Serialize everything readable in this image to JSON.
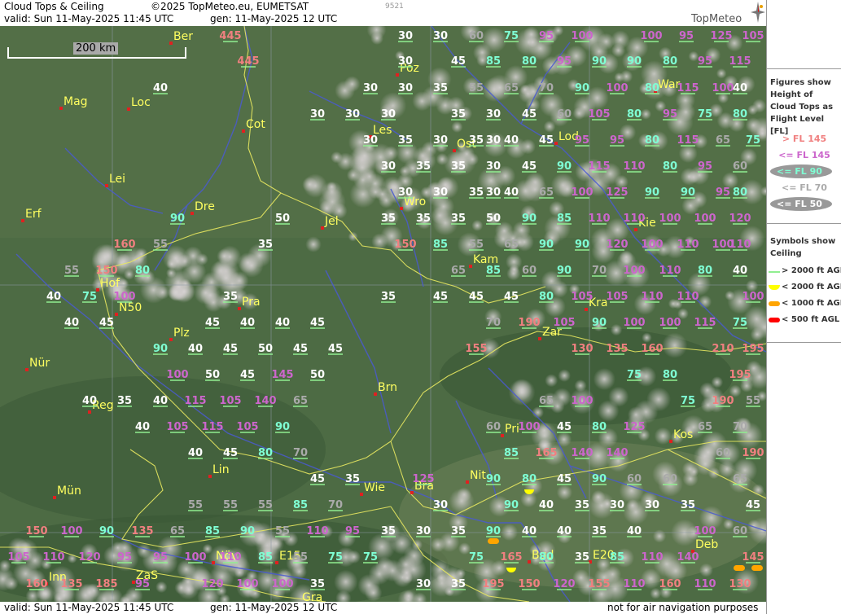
{
  "header": {
    "title": "Cloud Tops & Ceiling",
    "copyright": "©2025 TopMeteo.eu, EUMETSAT",
    "code": "9521",
    "valid": "valid:  Sun  11-May-2025  11:45 UTC",
    "gen": "gen: 11-May-2025 12 UTC",
    "brand": "TopMeteo"
  },
  "footer": {
    "valid": "valid:  Sun  11-May-2025  11:45 UTC",
    "gen": "gen: 11-May-2025 12 UTC",
    "disclaimer": "not for air navigation purposes"
  },
  "scale_label": "200 km",
  "legend": {
    "figures_title": "Figures show Height of Cloud Tops as Flight Level  [FL]",
    "levels": [
      {
        "label": "> FL 145",
        "color": "#f08080"
      },
      {
        "label": "<= FL 145",
        "color": "#cc66cc"
      },
      {
        "label": "<= FL 90",
        "color": "#7fffd4"
      },
      {
        "label": "<= FL 70",
        "color": "#aaaaaa"
      },
      {
        "label": "<= FL 50",
        "color": "#ffffff"
      }
    ],
    "symbols_title": "Symbols show Ceiling",
    "symbols": [
      {
        "label": "> 2000 ft AGL",
        "color": "#90ee90",
        "shape": "line"
      },
      {
        "label": "< 2000 ft AGL",
        "color": "#ffff00",
        "shape": "half-disc"
      },
      {
        "label": "< 1000 ft AGL",
        "color": "#ffa500",
        "shape": "pill"
      },
      {
        "label": "< 500 ft AGL",
        "color": "#ff0000",
        "shape": "pill"
      }
    ]
  },
  "cities": [
    "Ber",
    "Poz",
    "War",
    "Mag",
    "Loc",
    "Cot",
    "Les",
    "Lod",
    "Ost",
    "Lei",
    "Wro",
    "Kie",
    "Erf",
    "Dre",
    "Jel",
    "Kam",
    "Hof",
    "N50",
    "Pra",
    "Kra",
    "Plz",
    "Zar",
    "Nür",
    "Brn",
    "Reg",
    "Pri",
    "Kos",
    "Lin",
    "Nit",
    "Mün",
    "Wie",
    "Bra",
    "Bud",
    "E20",
    "Deb",
    "Inn",
    "ZaS",
    "Növ",
    "E15",
    "Gra",
    "Lie"
  ],
  "figures": [
    {
      "t": "445",
      "c": "#f08080"
    },
    {
      "t": "30",
      "c": "#ffffff"
    },
    {
      "t": "30",
      "c": "#ffffff"
    },
    {
      "t": "60",
      "c": "#aaaaaa"
    },
    {
      "t": "75",
      "c": "#7fffd4"
    },
    {
      "t": "95",
      "c": "#cc66cc"
    },
    {
      "t": "100",
      "c": "#cc66cc"
    },
    {
      "t": "100",
      "c": "#cc66cc"
    },
    {
      "t": "95",
      "c": "#cc66cc"
    },
    {
      "t": "125",
      "c": "#cc66cc"
    },
    {
      "t": "105",
      "c": "#cc66cc"
    },
    {
      "t": "445",
      "c": "#f08080"
    },
    {
      "t": "30",
      "c": "#ffffff"
    },
    {
      "t": "45",
      "c": "#ffffff"
    },
    {
      "t": "85",
      "c": "#7fffd4"
    },
    {
      "t": "80",
      "c": "#7fffd4"
    },
    {
      "t": "95",
      "c": "#cc66cc"
    },
    {
      "t": "90",
      "c": "#7fffd4"
    },
    {
      "t": "90",
      "c": "#7fffd4"
    },
    {
      "t": "80",
      "c": "#7fffd4"
    },
    {
      "t": "95",
      "c": "#cc66cc"
    },
    {
      "t": "115",
      "c": "#cc66cc"
    },
    {
      "t": "40",
      "c": "#ffffff"
    },
    {
      "t": "30",
      "c": "#ffffff"
    },
    {
      "t": "30",
      "c": "#ffffff"
    },
    {
      "t": "35",
      "c": "#ffffff"
    },
    {
      "t": "55",
      "c": "#aaaaaa"
    },
    {
      "t": "65",
      "c": "#aaaaaa"
    },
    {
      "t": "70",
      "c": "#aaaaaa"
    },
    {
      "t": "90",
      "c": "#7fffd4"
    },
    {
      "t": "100",
      "c": "#cc66cc"
    },
    {
      "t": "80",
      "c": "#7fffd4"
    },
    {
      "t": "115",
      "c": "#cc66cc"
    },
    {
      "t": "100",
      "c": "#cc66cc"
    },
    {
      "t": "40",
      "c": "#ffffff"
    },
    {
      "t": "30",
      "c": "#ffffff"
    },
    {
      "t": "30",
      "c": "#ffffff"
    },
    {
      "t": "30",
      "c": "#ffffff"
    },
    {
      "t": "35",
      "c": "#ffffff"
    },
    {
      "t": "30",
      "c": "#ffffff"
    },
    {
      "t": "45",
      "c": "#ffffff"
    },
    {
      "t": "60",
      "c": "#aaaaaa"
    },
    {
      "t": "105",
      "c": "#cc66cc"
    },
    {
      "t": "80",
      "c": "#7fffd4"
    },
    {
      "t": "95",
      "c": "#cc66cc"
    },
    {
      "t": "75",
      "c": "#7fffd4"
    },
    {
      "t": "80",
      "c": "#7fffd4"
    },
    {
      "t": "30",
      "c": "#ffffff"
    },
    {
      "t": "35",
      "c": "#ffffff"
    },
    {
      "t": "30",
      "c": "#ffffff"
    },
    {
      "t": "35",
      "c": "#ffffff"
    },
    {
      "t": "30",
      "c": "#ffffff"
    },
    {
      "t": "40",
      "c": "#ffffff"
    },
    {
      "t": "45",
      "c": "#ffffff"
    },
    {
      "t": "95",
      "c": "#cc66cc"
    },
    {
      "t": "95",
      "c": "#cc66cc"
    },
    {
      "t": "80",
      "c": "#7fffd4"
    },
    {
      "t": "115",
      "c": "#cc66cc"
    },
    {
      "t": "65",
      "c": "#aaaaaa"
    },
    {
      "t": "75",
      "c": "#7fffd4"
    },
    {
      "t": "30",
      "c": "#ffffff"
    },
    {
      "t": "35",
      "c": "#ffffff"
    },
    {
      "t": "35",
      "c": "#ffffff"
    },
    {
      "t": "30",
      "c": "#ffffff"
    },
    {
      "t": "45",
      "c": "#ffffff"
    },
    {
      "t": "90",
      "c": "#7fffd4"
    },
    {
      "t": "115",
      "c": "#cc66cc"
    },
    {
      "t": "110",
      "c": "#cc66cc"
    },
    {
      "t": "80",
      "c": "#7fffd4"
    },
    {
      "t": "95",
      "c": "#cc66cc"
    },
    {
      "t": "60",
      "c": "#aaaaaa"
    },
    {
      "t": "30",
      "c": "#ffffff"
    },
    {
      "t": "30",
      "c": "#ffffff"
    },
    {
      "t": "35",
      "c": "#ffffff"
    },
    {
      "t": "30",
      "c": "#ffffff"
    },
    {
      "t": "40",
      "c": "#ffffff"
    },
    {
      "t": "65",
      "c": "#aaaaaa"
    },
    {
      "t": "100",
      "c": "#cc66cc"
    },
    {
      "t": "125",
      "c": "#cc66cc"
    },
    {
      "t": "90",
      "c": "#7fffd4"
    },
    {
      "t": "90",
      "c": "#7fffd4"
    },
    {
      "t": "95",
      "c": "#cc66cc"
    },
    {
      "t": "80",
      "c": "#7fffd4"
    },
    {
      "t": "90",
      "c": "#7fffd4"
    },
    {
      "t": "50",
      "c": "#ffffff"
    },
    {
      "t": "35",
      "c": "#ffffff"
    },
    {
      "t": "35",
      "c": "#ffffff"
    },
    {
      "t": "35",
      "c": "#ffffff"
    },
    {
      "t": "50",
      "c": "#ffffff"
    },
    {
      "t": "90",
      "c": "#7fffd4"
    },
    {
      "t": "85",
      "c": "#7fffd4"
    },
    {
      "t": "110",
      "c": "#cc66cc"
    },
    {
      "t": "110",
      "c": "#cc66cc"
    },
    {
      "t": "100",
      "c": "#cc66cc"
    },
    {
      "t": "100",
      "c": "#cc66cc"
    },
    {
      "t": "120",
      "c": "#cc66cc"
    },
    {
      "t": "160",
      "c": "#f08080"
    },
    {
      "t": "55",
      "c": "#aaaaaa"
    },
    {
      "t": "35",
      "c": "#ffffff"
    },
    {
      "t": "150",
      "c": "#f08080"
    },
    {
      "t": "85",
      "c": "#7fffd4"
    },
    {
      "t": "55",
      "c": "#aaaaaa"
    },
    {
      "t": "65",
      "c": "#aaaaaa"
    },
    {
      "t": "90",
      "c": "#7fffd4"
    },
    {
      "t": "90",
      "c": "#7fffd4"
    },
    {
      "t": "120",
      "c": "#cc66cc"
    },
    {
      "t": "100",
      "c": "#cc66cc"
    },
    {
      "t": "110",
      "c": "#cc66cc"
    },
    {
      "t": "100",
      "c": "#cc66cc"
    },
    {
      "t": "110",
      "c": "#cc66cc"
    },
    {
      "t": "55",
      "c": "#aaaaaa"
    },
    {
      "t": "150",
      "c": "#f08080"
    },
    {
      "t": "80",
      "c": "#7fffd4"
    },
    {
      "t": "65",
      "c": "#aaaaaa"
    },
    {
      "t": "85",
      "c": "#7fffd4"
    },
    {
      "t": "60",
      "c": "#aaaaaa"
    },
    {
      "t": "90",
      "c": "#7fffd4"
    },
    {
      "t": "70",
      "c": "#aaaaaa"
    },
    {
      "t": "100",
      "c": "#cc66cc"
    },
    {
      "t": "110",
      "c": "#cc66cc"
    },
    {
      "t": "80",
      "c": "#7fffd4"
    },
    {
      "t": "40",
      "c": "#ffffff"
    },
    {
      "t": "40",
      "c": "#ffffff"
    },
    {
      "t": "75",
      "c": "#7fffd4"
    },
    {
      "t": "100",
      "c": "#cc66cc"
    },
    {
      "t": "35",
      "c": "#ffffff"
    },
    {
      "t": "35",
      "c": "#ffffff"
    },
    {
      "t": "45",
      "c": "#ffffff"
    },
    {
      "t": "45",
      "c": "#ffffff"
    },
    {
      "t": "45",
      "c": "#ffffff"
    },
    {
      "t": "80",
      "c": "#7fffd4"
    },
    {
      "t": "105",
      "c": "#cc66cc"
    },
    {
      "t": "105",
      "c": "#cc66cc"
    },
    {
      "t": "110",
      "c": "#cc66cc"
    },
    {
      "t": "110",
      "c": "#cc66cc"
    },
    {
      "t": "100",
      "c": "#cc66cc"
    },
    {
      "t": "40",
      "c": "#ffffff"
    },
    {
      "t": "45",
      "c": "#ffffff"
    },
    {
      "t": "45",
      "c": "#ffffff"
    },
    {
      "t": "40",
      "c": "#ffffff"
    },
    {
      "t": "40",
      "c": "#ffffff"
    },
    {
      "t": "45",
      "c": "#ffffff"
    },
    {
      "t": "70",
      "c": "#aaaaaa"
    },
    {
      "t": "190",
      "c": "#f08080"
    },
    {
      "t": "105",
      "c": "#cc66cc"
    },
    {
      "t": "90",
      "c": "#7fffd4"
    },
    {
      "t": "100",
      "c": "#cc66cc"
    },
    {
      "t": "100",
      "c": "#cc66cc"
    },
    {
      "t": "115",
      "c": "#cc66cc"
    },
    {
      "t": "75",
      "c": "#7fffd4"
    },
    {
      "t": "90",
      "c": "#7fffd4"
    },
    {
      "t": "40",
      "c": "#ffffff"
    },
    {
      "t": "45",
      "c": "#ffffff"
    },
    {
      "t": "50",
      "c": "#ffffff"
    },
    {
      "t": "45",
      "c": "#ffffff"
    },
    {
      "t": "45",
      "c": "#ffffff"
    },
    {
      "t": "155",
      "c": "#f08080"
    },
    {
      "t": "130",
      "c": "#f08080"
    },
    {
      "t": "135",
      "c": "#f08080"
    },
    {
      "t": "160",
      "c": "#f08080"
    },
    {
      "t": "210",
      "c": "#f08080"
    },
    {
      "t": "195",
      "c": "#f08080"
    },
    {
      "t": "100",
      "c": "#cc66cc"
    },
    {
      "t": "50",
      "c": "#ffffff"
    },
    {
      "t": "45",
      "c": "#ffffff"
    },
    {
      "t": "145",
      "c": "#cc66cc"
    },
    {
      "t": "50",
      "c": "#ffffff"
    },
    {
      "t": "75",
      "c": "#7fffd4"
    },
    {
      "t": "80",
      "c": "#7fffd4"
    },
    {
      "t": "195",
      "c": "#f08080"
    },
    {
      "t": "40",
      "c": "#ffffff"
    },
    {
      "t": "35",
      "c": "#ffffff"
    },
    {
      "t": "40",
      "c": "#ffffff"
    },
    {
      "t": "115",
      "c": "#cc66cc"
    },
    {
      "t": "105",
      "c": "#cc66cc"
    },
    {
      "t": "140",
      "c": "#cc66cc"
    },
    {
      "t": "65",
      "c": "#aaaaaa"
    },
    {
      "t": "65",
      "c": "#aaaaaa"
    },
    {
      "t": "100",
      "c": "#cc66cc"
    },
    {
      "t": "75",
      "c": "#7fffd4"
    },
    {
      "t": "190",
      "c": "#f08080"
    },
    {
      "t": "55",
      "c": "#aaaaaa"
    },
    {
      "t": "40",
      "c": "#ffffff"
    },
    {
      "t": "105",
      "c": "#cc66cc"
    },
    {
      "t": "115",
      "c": "#cc66cc"
    },
    {
      "t": "105",
      "c": "#cc66cc"
    },
    {
      "t": "90",
      "c": "#7fffd4"
    },
    {
      "t": "60",
      "c": "#aaaaaa"
    },
    {
      "t": "100",
      "c": "#cc66cc"
    },
    {
      "t": "45",
      "c": "#ffffff"
    },
    {
      "t": "80",
      "c": "#7fffd4"
    },
    {
      "t": "125",
      "c": "#cc66cc"
    },
    {
      "t": "65",
      "c": "#aaaaaa"
    },
    {
      "t": "70",
      "c": "#aaaaaa"
    },
    {
      "t": "40",
      "c": "#ffffff"
    },
    {
      "t": "45",
      "c": "#ffffff"
    },
    {
      "t": "80",
      "c": "#7fffd4"
    },
    {
      "t": "70",
      "c": "#aaaaaa"
    },
    {
      "t": "85",
      "c": "#7fffd4"
    },
    {
      "t": "165",
      "c": "#f08080"
    },
    {
      "t": "140",
      "c": "#cc66cc"
    },
    {
      "t": "140",
      "c": "#cc66cc"
    },
    {
      "t": "60",
      "c": "#aaaaaa"
    },
    {
      "t": "190",
      "c": "#f08080"
    },
    {
      "t": "45",
      "c": "#ffffff"
    },
    {
      "t": "35",
      "c": "#ffffff"
    },
    {
      "t": "125",
      "c": "#cc66cc"
    },
    {
      "t": "90",
      "c": "#7fffd4"
    },
    {
      "t": "80",
      "c": "#7fffd4"
    },
    {
      "t": "45",
      "c": "#ffffff"
    },
    {
      "t": "90",
      "c": "#7fffd4"
    },
    {
      "t": "60",
      "c": "#aaaaaa"
    },
    {
      "t": "60",
      "c": "#aaaaaa"
    },
    {
      "t": "65",
      "c": "#aaaaaa"
    },
    {
      "t": "55",
      "c": "#aaaaaa"
    },
    {
      "t": "55",
      "c": "#aaaaaa"
    },
    {
      "t": "55",
      "c": "#aaaaaa"
    },
    {
      "t": "85",
      "c": "#7fffd4"
    },
    {
      "t": "70",
      "c": "#aaaaaa"
    },
    {
      "t": "30",
      "c": "#ffffff"
    },
    {
      "t": "90",
      "c": "#7fffd4"
    },
    {
      "t": "40",
      "c": "#ffffff"
    },
    {
      "t": "35",
      "c": "#ffffff"
    },
    {
      "t": "30",
      "c": "#ffffff"
    },
    {
      "t": "30",
      "c": "#ffffff"
    },
    {
      "t": "35",
      "c": "#ffffff"
    },
    {
      "t": "45",
      "c": "#ffffff"
    },
    {
      "t": "150",
      "c": "#f08080"
    },
    {
      "t": "100",
      "c": "#cc66cc"
    },
    {
      "t": "90",
      "c": "#7fffd4"
    },
    {
      "t": "135",
      "c": "#f08080"
    },
    {
      "t": "65",
      "c": "#aaaaaa"
    },
    {
      "t": "85",
      "c": "#7fffd4"
    },
    {
      "t": "90",
      "c": "#7fffd4"
    },
    {
      "t": "55",
      "c": "#aaaaaa"
    },
    {
      "t": "110",
      "c": "#cc66cc"
    },
    {
      "t": "95",
      "c": "#cc66cc"
    },
    {
      "t": "35",
      "c": "#ffffff"
    },
    {
      "t": "30",
      "c": "#ffffff"
    },
    {
      "t": "35",
      "c": "#ffffff"
    },
    {
      "t": "90",
      "c": "#7fffd4"
    },
    {
      "t": "40",
      "c": "#ffffff"
    },
    {
      "t": "40",
      "c": "#ffffff"
    },
    {
      "t": "35",
      "c": "#ffffff"
    },
    {
      "t": "40",
      "c": "#ffffff"
    },
    {
      "t": "100",
      "c": "#cc66cc"
    },
    {
      "t": "60",
      "c": "#aaaaaa"
    },
    {
      "t": "105",
      "c": "#cc66cc"
    },
    {
      "t": "110",
      "c": "#cc66cc"
    },
    {
      "t": "120",
      "c": "#cc66cc"
    },
    {
      "t": "95",
      "c": "#cc66cc"
    },
    {
      "t": "95",
      "c": "#cc66cc"
    },
    {
      "t": "100",
      "c": "#cc66cc"
    },
    {
      "t": "110",
      "c": "#cc66cc"
    },
    {
      "t": "85",
      "c": "#7fffd4"
    },
    {
      "t": "55",
      "c": "#aaaaaa"
    },
    {
      "t": "75",
      "c": "#7fffd4"
    },
    {
      "t": "75",
      "c": "#7fffd4"
    },
    {
      "t": "75",
      "c": "#7fffd4"
    },
    {
      "t": "165",
      "c": "#f08080"
    },
    {
      "t": "80",
      "c": "#7fffd4"
    },
    {
      "t": "35",
      "c": "#ffffff"
    },
    {
      "t": "85",
      "c": "#7fffd4"
    },
    {
      "t": "110",
      "c": "#cc66cc"
    },
    {
      "t": "140",
      "c": "#cc66cc"
    },
    {
      "t": "145",
      "c": "#f08080"
    },
    {
      "t": "160",
      "c": "#f08080"
    },
    {
      "t": "135",
      "c": "#f08080"
    },
    {
      "t": "185",
      "c": "#f08080"
    },
    {
      "t": "95",
      "c": "#cc66cc"
    },
    {
      "t": "120",
      "c": "#cc66cc"
    },
    {
      "t": "100",
      "c": "#cc66cc"
    },
    {
      "t": "100",
      "c": "#cc66cc"
    },
    {
      "t": "35",
      "c": "#ffffff"
    },
    {
      "t": "30",
      "c": "#ffffff"
    },
    {
      "t": "35",
      "c": "#ffffff"
    },
    {
      "t": "195",
      "c": "#f08080"
    },
    {
      "t": "150",
      "c": "#f08080"
    },
    {
      "t": "120",
      "c": "#cc66cc"
    },
    {
      "t": "155",
      "c": "#f08080"
    },
    {
      "t": "110",
      "c": "#cc66cc"
    },
    {
      "t": "160",
      "c": "#f08080"
    },
    {
      "t": "110",
      "c": "#cc66cc"
    },
    {
      "t": "130",
      "c": "#f08080"
    }
  ]
}
